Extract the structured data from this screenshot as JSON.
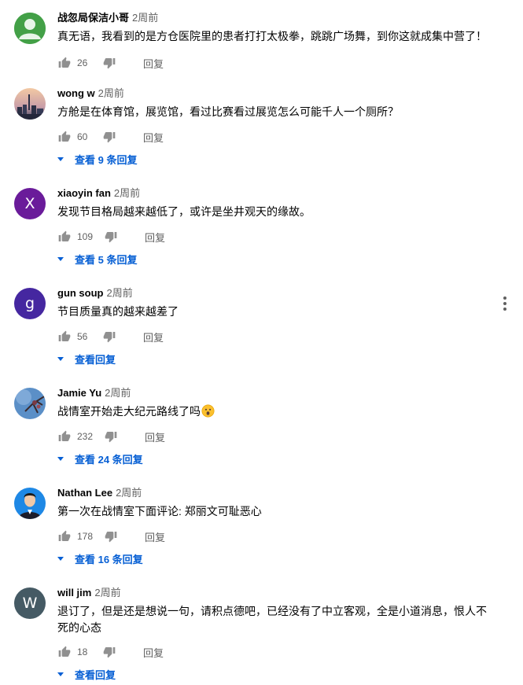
{
  "colors": {
    "link_blue": "#065fd4",
    "secondary_text": "#606060",
    "avatar_x": "#6a1b9a",
    "avatar_g": "#4527a0",
    "avatar_w": "#455a64"
  },
  "labels": {
    "reply": "回复"
  },
  "comments": [
    {
      "author": "战忽局保洁小哥",
      "time": "2周前",
      "text": "真无语，我看到的是方仓医院里的患者打打太极拳，跳跳广场舞，到你这就成集中营了！",
      "likes": "26",
      "replies_label": ""
    },
    {
      "author": "wong w",
      "time": "2周前",
      "text": "方舱是在体育馆，展览馆，看过比赛看过展览怎么可能千人一个厕所？",
      "likes": "60",
      "replies_label": "查看 9 条回复"
    },
    {
      "author": "xiaoyin fan",
      "time": "2周前",
      "avatar_letter": "X",
      "text": "发现节目格局越来越低了，或许是坐井观天的缘故。",
      "likes": "109",
      "replies_label": "查看 5 条回复"
    },
    {
      "author": "gun soup",
      "time": "2周前",
      "avatar_letter": "g",
      "text": "节目质量真的越来越差了",
      "likes": "56",
      "replies_label": "查看回复"
    },
    {
      "author": "Jamie Yu",
      "time": "2周前",
      "text": "战情室开始走大纪元路线了吗",
      "likes": "232",
      "replies_label": "查看 24 条回复"
    },
    {
      "author": "Nathan Lee",
      "time": "2周前",
      "text": "第一次在战情室下面评论: 郑丽文可耻恶心",
      "likes": "178",
      "replies_label": "查看 16 条回复"
    },
    {
      "author": "will jim",
      "time": "2周前",
      "avatar_letter": "W",
      "text": "退订了，但是还是想说一句，请积点德吧，已经没有了中立客观，全是小道消息，恨人不死的心态",
      "likes": "18",
      "replies_label": "查看回复"
    }
  ]
}
